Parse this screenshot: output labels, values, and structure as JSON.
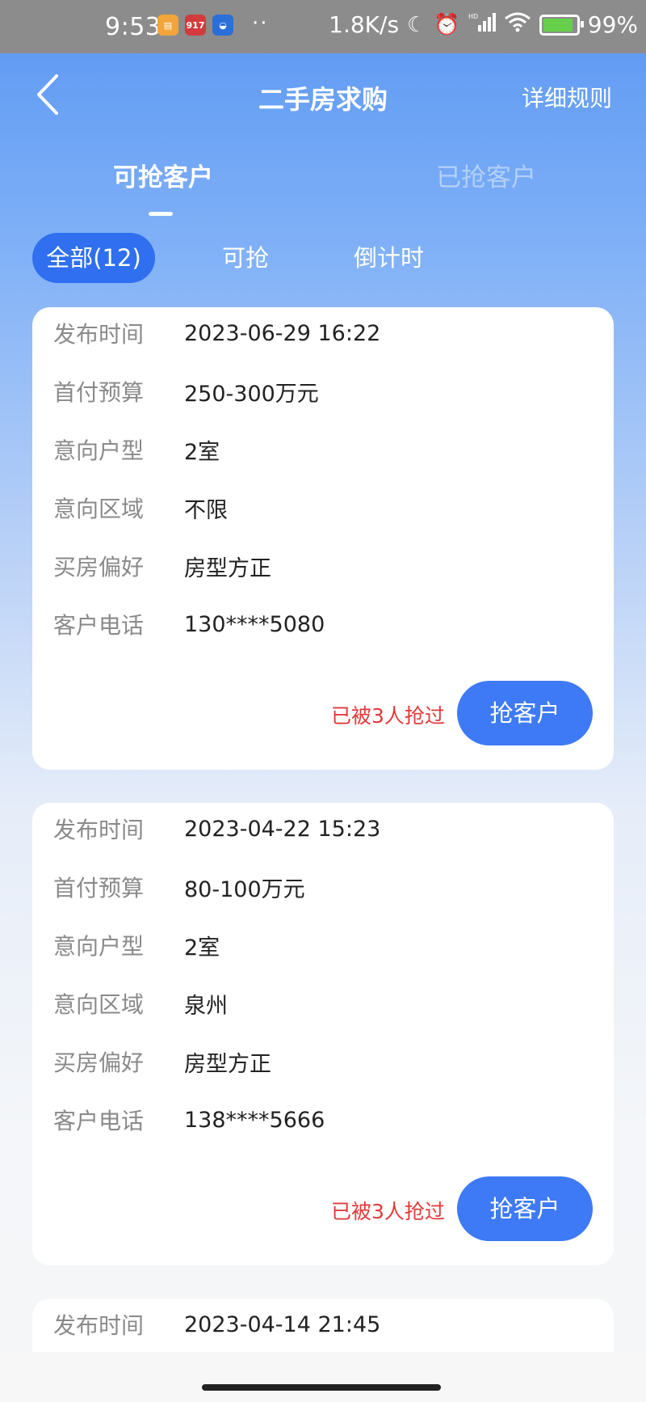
{
  "status_bar": {
    "time": "9:53",
    "app_icon_2": "917",
    "dots": "··",
    "net_speed": "1.8K/s",
    "moon_icon": "moon-icon",
    "alarm_icon": "alarm-icon",
    "signal_icon": "signal-icon",
    "wifi_icon": "wifi-icon",
    "battery_level": 0.99,
    "battery_text": "99%"
  },
  "header": {
    "title": "二手房求购",
    "rules": "详细规则"
  },
  "tabs": [
    {
      "label": "可抢客户",
      "active": true
    },
    {
      "label": "已抢客户",
      "active": false
    }
  ],
  "filters": [
    {
      "label": "全部(12)",
      "active": true
    },
    {
      "label": "可抢",
      "active": false
    },
    {
      "label": "倒计时",
      "active": false
    }
  ],
  "cards": [
    {
      "rows": [
        {
          "label": "发布时间",
          "value": "2023-06-29 16:22"
        },
        {
          "label": "首付预算",
          "value": "250-300万元"
        },
        {
          "label": "意向户型",
          "value": "2室"
        },
        {
          "label": "意向区域",
          "value": "不限"
        },
        {
          "label": "买房偏好",
          "value": "房型方正"
        },
        {
          "label": "客户电话",
          "value": "130****5080"
        }
      ],
      "grabbed_text": "已被3人抢过",
      "button": "抢客户"
    },
    {
      "rows": [
        {
          "label": "发布时间",
          "value": "2023-04-22 15:23"
        },
        {
          "label": "首付预算",
          "value": "80-100万元"
        },
        {
          "label": "意向户型",
          "value": "2室"
        },
        {
          "label": "意向区域",
          "value": "泉州"
        },
        {
          "label": "买房偏好",
          "value": "房型方正"
        },
        {
          "label": "客户电话",
          "value": "138****5666"
        }
      ],
      "grabbed_text": "已被3人抢过",
      "button": "抢客户"
    },
    {
      "rows": [
        {
          "label": "发布时间",
          "value": "2023-04-14 21:45"
        }
      ]
    }
  ],
  "colors": {
    "accent": "#3e7af5",
    "chip_active": "#2f6ff0",
    "warning_text": "#e23a3a"
  }
}
